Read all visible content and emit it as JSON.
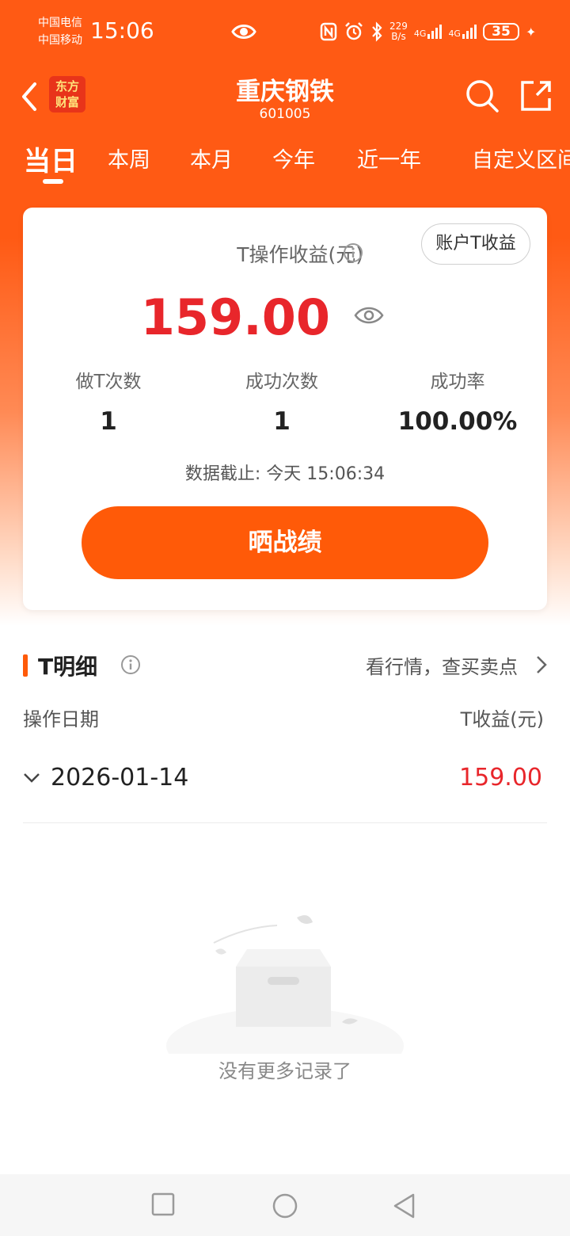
{
  "status_bar": {
    "carrier1": "中国电信",
    "carrier2": "中国移动",
    "time": "15:06",
    "net_speed_value": "229",
    "net_speed_unit": "B/s",
    "signal1_label": "4G",
    "signal2_label": "4G",
    "battery": "35"
  },
  "header": {
    "logo_line1": "东方",
    "logo_line2": "财富",
    "stock_name": "重庆钢铁",
    "stock_code": "601005"
  },
  "tabs": [
    {
      "label": "当日",
      "active": true
    },
    {
      "label": "本周"
    },
    {
      "label": "本月"
    },
    {
      "label": "今年"
    },
    {
      "label": "近一年"
    },
    {
      "label": "自定义区间"
    }
  ],
  "summary": {
    "title": "T操作收益(元)",
    "account_button": "账户T收益",
    "profit": "159.00",
    "stats": [
      {
        "label": "做T次数",
        "value": "1"
      },
      {
        "label": "成功次数",
        "value": "1"
      },
      {
        "label": "成功率",
        "value": "100.00%"
      }
    ],
    "cutoff_text": "数据截止: 今天 15:06:34",
    "cta": "晒战绩"
  },
  "detail": {
    "title": "T明细",
    "quote_link": "看行情，查买卖点",
    "col_date": "操作日期",
    "col_profit": "T收益(元)",
    "rows": [
      {
        "date": "2026-01-14",
        "profit": "159.00"
      }
    ],
    "empty_text": "没有更多记录了"
  },
  "colors": {
    "brand_orange": "#ff5a14",
    "profit_red": "#e8262b"
  }
}
